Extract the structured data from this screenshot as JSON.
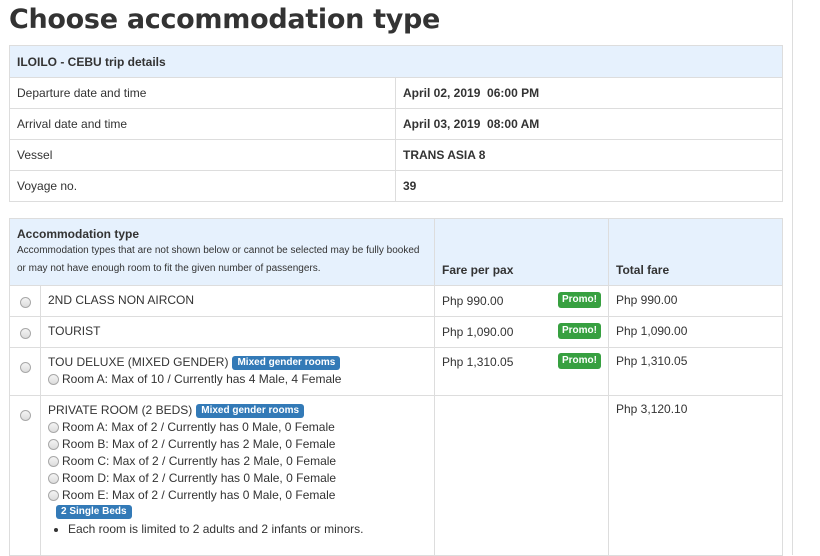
{
  "page_title": "Choose accommodation type",
  "trip": {
    "header": "ILOILO - CEBU trip details",
    "rows": [
      {
        "label": "Departure date and time",
        "value": "April 02, 2019  06:00 PM"
      },
      {
        "label": "Arrival date and time",
        "value": "April 03, 2019  08:00 AM"
      },
      {
        "label": "Vessel",
        "value": "TRANS ASIA 8"
      },
      {
        "label": "Voyage no.",
        "value": "39"
      }
    ]
  },
  "accommodation": {
    "header_title": "Accommodation type",
    "header_note": "Accommodation types that are not shown below or cannot be selected may be fully booked or may not have enough room to fit the given number of passengers.",
    "col_fare": "Fare per pax",
    "col_total": "Total fare",
    "options": [
      {
        "name": "2ND CLASS NON AIRCON",
        "fare": "Php 990.00",
        "promo": "Promo!",
        "total": "Php 990.00"
      },
      {
        "name": "TOURIST",
        "fare": "Php 1,090.00",
        "promo": "Promo!",
        "total": "Php 1,090.00"
      },
      {
        "name": "TOU DELUXE (MIXED GENDER)",
        "badge": "Mixed gender rooms",
        "fare": "Php 1,310.05",
        "promo": "Promo!",
        "total": "Php 1,310.05",
        "rooms": [
          "Room A: Max of 10 / Currently has 4 Male, 4 Female"
        ]
      },
      {
        "name": "PRIVATE ROOM (2 BEDS)",
        "badge": "Mixed gender rooms",
        "fare": "",
        "total": "Php 3,120.10",
        "rooms": [
          "Room A: Max of 2 / Currently has 0 Male, 0 Female",
          "Room B: Max of 2 / Currently has 2 Male, 0 Female",
          "Room C: Max of 2 / Currently has 2 Male, 0 Female",
          "Room D: Max of 2 / Currently has 0 Male, 0 Female",
          "Room E: Max of 2 / Currently has 0 Male, 0 Female"
        ],
        "beds_badge": "2 Single Beds",
        "note": "Each room is limited to 2 adults and 2 infants or minors."
      }
    ]
  }
}
